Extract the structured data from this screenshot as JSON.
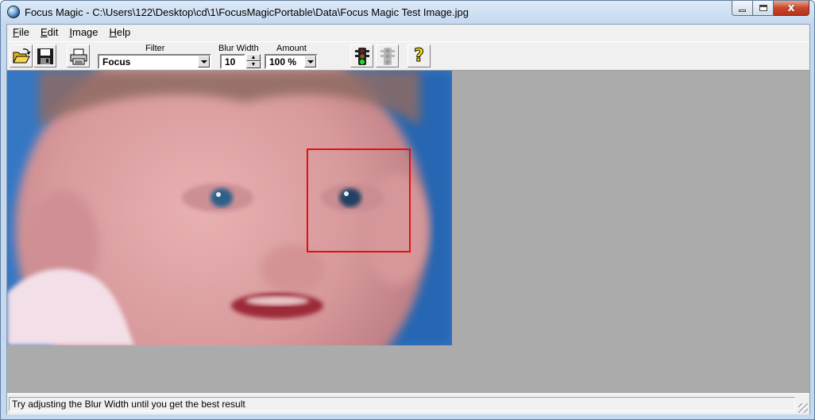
{
  "window": {
    "title": "Focus Magic - C:\\Users\\122\\Desktop\\cd\\1\\FocusMagicPortable\\Data\\Focus Magic Test Image.jpg"
  },
  "caption_buttons": {
    "minimize_icon": "minimize-icon",
    "maximize_icon": "maximize-icon",
    "close_label": "x"
  },
  "menu": {
    "items": [
      {
        "accel": "F",
        "rest": "ile"
      },
      {
        "accel": "E",
        "rest": "dit"
      },
      {
        "accel": "I",
        "rest": "mage"
      },
      {
        "accel": "H",
        "rest": "elp"
      }
    ]
  },
  "toolbar": {
    "open_icon": "open-folder-icon",
    "save_icon": "floppy-disk-icon",
    "print_icon": "printer-icon",
    "filter_label": "Filter",
    "filter_value": "Focus",
    "blur_width_label": "Blur Width",
    "blur_width_value": "10",
    "amount_label": "Amount",
    "amount_value": "100 %",
    "go_icon": "traffic-light-icon",
    "stop_icon": "traffic-light-disabled-icon",
    "help_label": "?"
  },
  "colors": {
    "workspace_bg": "#ababab",
    "selection_border": "#e01010",
    "photo_bg": "#3a7fc6"
  },
  "statusbar": {
    "text": "Try adjusting the Blur Width until you get the best result"
  }
}
